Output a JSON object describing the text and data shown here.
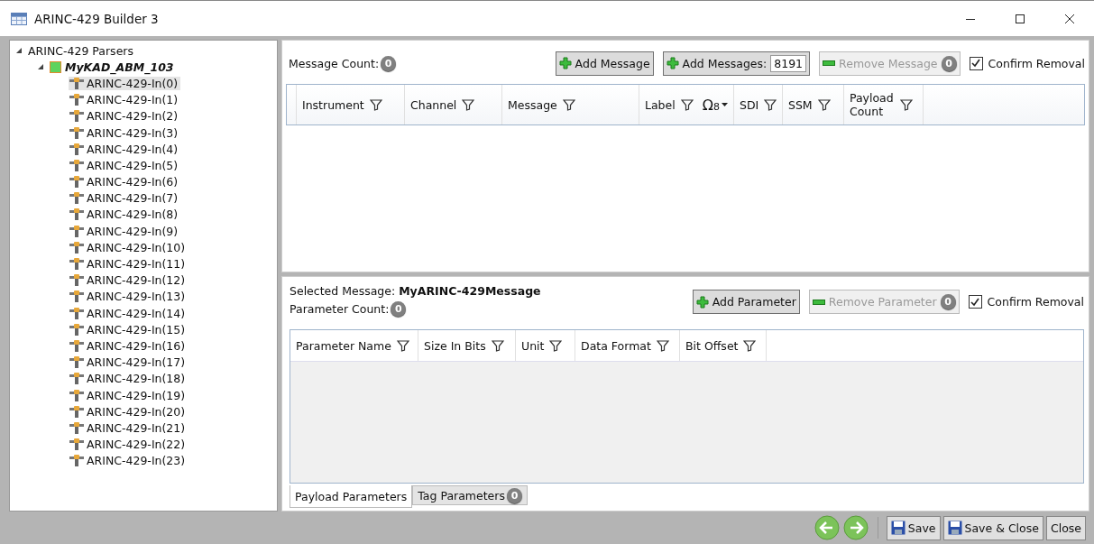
{
  "window": {
    "title": "ARINC-429 Builder 3"
  },
  "tree": {
    "label": "ARINC-429 Parsers",
    "expanded": true,
    "children": [
      {
        "label": "MyKAD_ABM_103",
        "expanded": true,
        "children": [
          {
            "label": "ARINC-429-In(0)",
            "selected": true
          },
          {
            "label": "ARINC-429-In(1)",
            "selected": false
          },
          {
            "label": "ARINC-429-In(2)",
            "selected": false
          },
          {
            "label": "ARINC-429-In(3)",
            "selected": false
          },
          {
            "label": "ARINC-429-In(4)",
            "selected": false
          },
          {
            "label": "ARINC-429-In(5)",
            "selected": false
          },
          {
            "label": "ARINC-429-In(6)",
            "selected": false
          },
          {
            "label": "ARINC-429-In(7)",
            "selected": false
          },
          {
            "label": "ARINC-429-In(8)",
            "selected": false
          },
          {
            "label": "ARINC-429-In(9)",
            "selected": false
          },
          {
            "label": "ARINC-429-In(10)",
            "selected": false
          },
          {
            "label": "ARINC-429-In(11)",
            "selected": false
          },
          {
            "label": "ARINC-429-In(12)",
            "selected": false
          },
          {
            "label": "ARINC-429-In(13)",
            "selected": false
          },
          {
            "label": "ARINC-429-In(14)",
            "selected": false
          },
          {
            "label": "ARINC-429-In(15)",
            "selected": false
          },
          {
            "label": "ARINC-429-In(16)",
            "selected": false
          },
          {
            "label": "ARINC-429-In(17)",
            "selected": false
          },
          {
            "label": "ARINC-429-In(18)",
            "selected": false
          },
          {
            "label": "ARINC-429-In(19)",
            "selected": false
          },
          {
            "label": "ARINC-429-In(20)",
            "selected": false
          },
          {
            "label": "ARINC-429-In(21)",
            "selected": false
          },
          {
            "label": "ARINC-429-In(22)",
            "selected": false
          },
          {
            "label": "ARINC-429-In(23)",
            "selected": false
          }
        ]
      }
    ]
  },
  "messages": {
    "count_label": "Message Count:",
    "count": "0",
    "buttons": [
      {
        "kind": "add",
        "label": "Add Message",
        "disabled": false
      },
      {
        "kind": "add",
        "label": "Add Messages:",
        "disabled": false,
        "value": "8191"
      },
      {
        "kind": "remove",
        "label": "Remove Message",
        "disabled": true,
        "badge": "0"
      }
    ],
    "confirm": {
      "label": "Confirm Removal",
      "checked": true
    },
    "columns": [
      {
        "label": "Instrument"
      },
      {
        "label": "Channel"
      },
      {
        "label": "Message"
      },
      {
        "label": "Label",
        "radix": "Ω$_{8}$"
      },
      {
        "label": "SDI"
      },
      {
        "label": "SSM"
      },
      {
        "label": "Payload Count"
      }
    ]
  },
  "parameters": {
    "selected_label": "Selected Message:",
    "selected_value": "MyARINC-429Message",
    "count_label": "Parameter Count:",
    "count": "0",
    "buttons": [
      {
        "kind": "add",
        "label": "Add Parameter",
        "disabled": false
      },
      {
        "kind": "remove",
        "label": "Remove Parameter",
        "disabled": true,
        "badge": "0"
      }
    ],
    "confirm": {
      "label": "Confirm Removal",
      "checked": true
    },
    "columns": [
      {
        "label": "Parameter Name"
      },
      {
        "label": "Size In Bits"
      },
      {
        "label": "Unit"
      },
      {
        "label": "Data Format"
      },
      {
        "label": "Bit Offset"
      }
    ],
    "tabs": [
      {
        "label": "Payload Parameters",
        "selected": true
      },
      {
        "label": "Tag Parameters",
        "selected": false,
        "badge": "0"
      }
    ]
  },
  "footer": {
    "nav": [
      {
        "kind": "back"
      },
      {
        "kind": "forward"
      }
    ],
    "buttons": [
      {
        "label": "Save",
        "kind": "save"
      },
      {
        "label": "Save & Close",
        "kind": "save"
      },
      {
        "label": "Close",
        "kind": "plain"
      }
    ]
  }
}
